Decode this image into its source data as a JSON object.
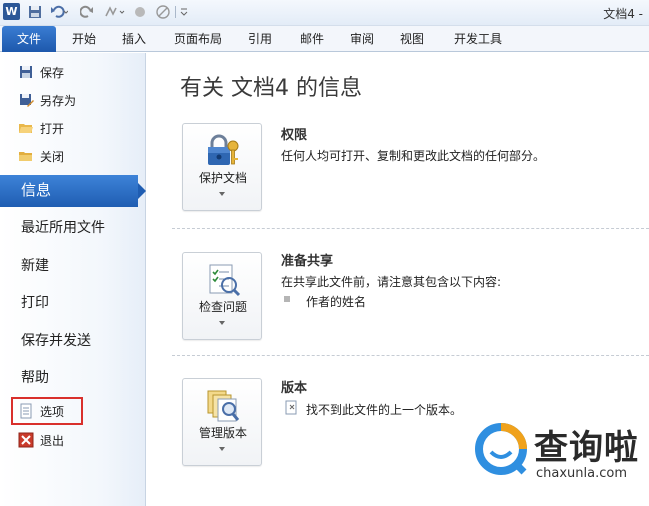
{
  "window": {
    "title": "文档4 -"
  },
  "quick_access": {
    "app_logo": "W",
    "icons": [
      "word-logo-icon",
      "save-icon",
      "undo-icon",
      "redo-icon",
      "repeat-icon",
      "circle-icon",
      "no-icon",
      "customize-icon"
    ]
  },
  "ribbon": {
    "tabs": [
      {
        "label": "文件",
        "active": true
      },
      {
        "label": "开始"
      },
      {
        "label": "插入"
      },
      {
        "label": "页面布局"
      },
      {
        "label": "引用"
      },
      {
        "label": "邮件"
      },
      {
        "label": "审阅"
      },
      {
        "label": "视图"
      },
      {
        "label": "开发工具"
      }
    ]
  },
  "nav": {
    "small_items": [
      {
        "label": "保存",
        "icon": "save-icon"
      },
      {
        "label": "另存为",
        "icon": "save-as-icon"
      },
      {
        "label": "打开",
        "icon": "open-folder-icon"
      },
      {
        "label": "关闭",
        "icon": "close-folder-icon"
      }
    ],
    "active": "信息",
    "big_items": [
      "最近所用文件",
      "新建",
      "打印",
      "保存并发送",
      "帮助"
    ],
    "bottom_items": [
      {
        "label": "选项",
        "icon": "options-icon",
        "highlighted": true
      },
      {
        "label": "退出",
        "icon": "exit-icon"
      }
    ]
  },
  "main": {
    "title": "有关 文档4 的信息",
    "sections": [
      {
        "button": "保护文档",
        "title": "权限",
        "text": "任何人均可打开、复制和更改此文档的任何部分。",
        "icon": "lock-key-icon"
      },
      {
        "button": "检查问题",
        "title": "准备共享",
        "text": "在共享此文件前，请注意其包含以下内容:",
        "bullet": "作者的姓名",
        "icon": "checklist-icon"
      },
      {
        "button": "管理版本",
        "title": "版本",
        "text": "找不到此文件的上一个版本。",
        "icon": "versions-icon"
      }
    ]
  },
  "watermark": {
    "text": "查询啦",
    "url": "chaxunla.com"
  },
  "colors": {
    "accent": "#1f5db2",
    "highlight_border": "#d9302c"
  }
}
